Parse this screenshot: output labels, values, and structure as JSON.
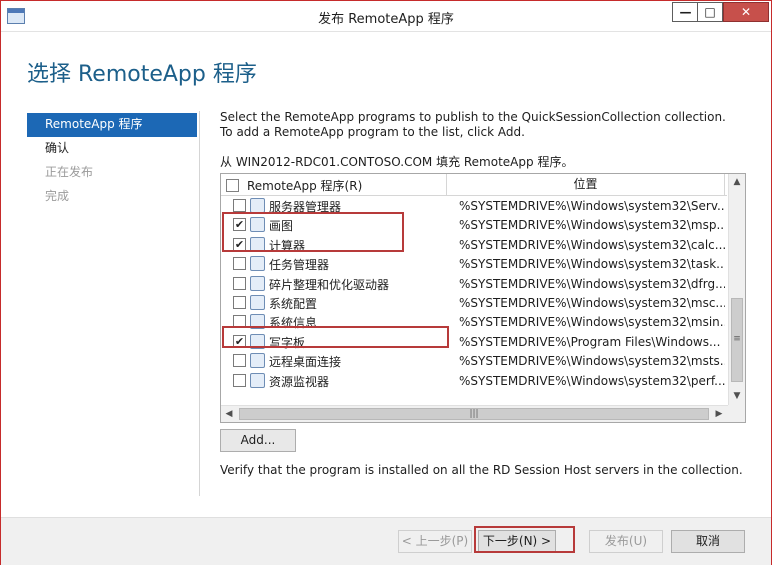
{
  "window": {
    "title": "发布 RemoteApp 程序"
  },
  "page_title": "选择 RemoteApp 程序",
  "nav": [
    {
      "label": "RemoteApp 程序",
      "state": "active"
    },
    {
      "label": "确认",
      "state": "normal"
    },
    {
      "label": "正在发布",
      "state": "disabled"
    },
    {
      "label": "完成",
      "state": "disabled"
    }
  ],
  "description": "Select the RemoteApp programs to publish to the QuickSessionCollection collection. To add a RemoteApp program to the list, click Add.",
  "source_line": "从 WIN2012-RDC01.CONTOSO.COM 填充 RemoteApp 程序。",
  "list": {
    "columns": [
      "RemoteApp 程序(R)",
      "位置"
    ],
    "rows": [
      {
        "name": "服务器管理器",
        "path": "%SYSTEMDRIVE%\\Windows\\system32\\Serv...",
        "checked": false,
        "icon": "server-manager-icon"
      },
      {
        "name": "画图",
        "path": "%SYSTEMDRIVE%\\Windows\\system32\\msp...",
        "checked": true,
        "icon": "paint-icon"
      },
      {
        "name": "计算器",
        "path": "%SYSTEMDRIVE%\\Windows\\system32\\calc...",
        "checked": true,
        "icon": "calculator-icon"
      },
      {
        "name": "任务管理器",
        "path": "%SYSTEMDRIVE%\\Windows\\system32\\task...",
        "checked": false,
        "icon": "task-manager-icon"
      },
      {
        "name": "碎片整理和优化驱动器",
        "path": "%SYSTEMDRIVE%\\Windows\\system32\\dfrg...",
        "checked": false,
        "icon": "defrag-icon"
      },
      {
        "name": "系统配置",
        "path": "%SYSTEMDRIVE%\\Windows\\system32\\msc...",
        "checked": false,
        "icon": "system-config-icon"
      },
      {
        "name": "系统信息",
        "path": "%SYSTEMDRIVE%\\Windows\\system32\\msin...",
        "checked": false,
        "icon": "system-info-icon"
      },
      {
        "name": "写字板",
        "path": "%SYSTEMDRIVE%\\Program Files\\Windows...",
        "checked": true,
        "icon": "wordpad-icon"
      },
      {
        "name": "远程桌面连接",
        "path": "%SYSTEMDRIVE%\\Windows\\system32\\msts...",
        "checked": false,
        "icon": "remote-desktop-icon"
      },
      {
        "name": "资源监视器",
        "path": "%SYSTEMDRIVE%\\Windows\\system32\\perf...",
        "checked": false,
        "icon": "resource-monitor-icon"
      }
    ]
  },
  "add_button": "Add...",
  "verify_text": "Verify that the program is installed on all the RD Session Host servers in the collection.",
  "footer": {
    "prev": "< 上一步(P)",
    "next": "下一步(N) >",
    "publish": "发布(U)",
    "cancel": "取消"
  },
  "colors": {
    "accent": "#1c68b5",
    "title": "#1c5f8a",
    "highlight": "#b73a3a"
  }
}
